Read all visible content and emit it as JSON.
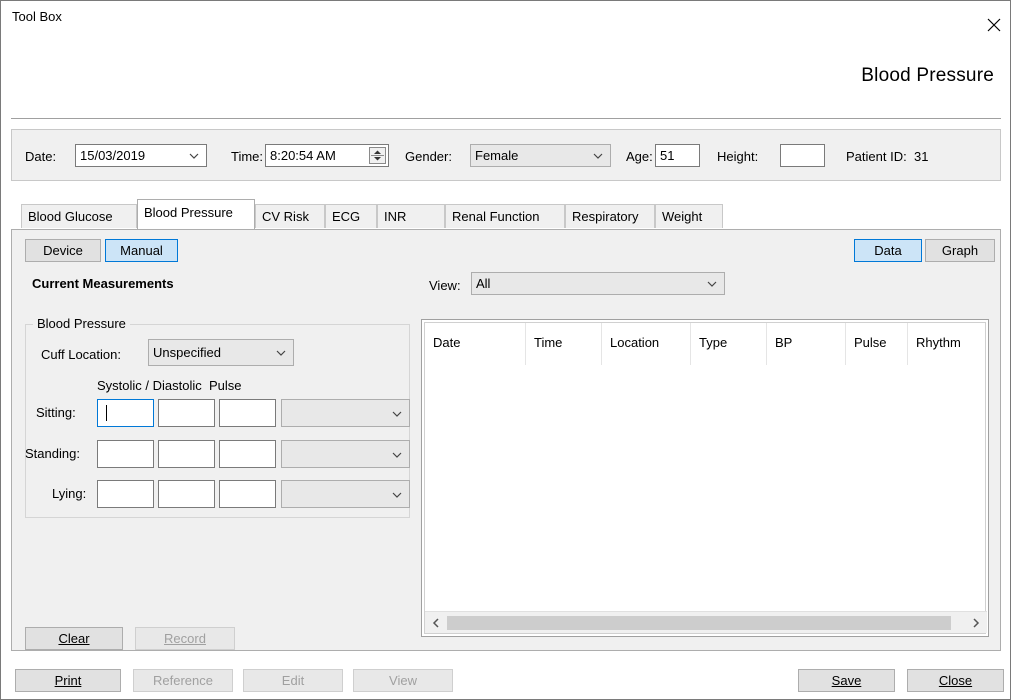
{
  "window": {
    "title": "Tool Box"
  },
  "header": {
    "title": "Blood Pressure"
  },
  "patient": {
    "date_label": "Date:",
    "date_value": "15/03/2019",
    "time_label": "Time:",
    "time_value": "8:20:54 AM",
    "gender_label": "Gender:",
    "gender_value": "Female",
    "age_label": "Age:",
    "age_value": "51",
    "height_label": "Height:",
    "height_value": "",
    "patient_id_label": "Patient ID:",
    "patient_id_value": "31"
  },
  "tabs": [
    {
      "label": "Blood Glucose"
    },
    {
      "label": "Blood Pressure"
    },
    {
      "label": "CV Risk"
    },
    {
      "label": "ECG"
    },
    {
      "label": "INR"
    },
    {
      "label": "Renal Function"
    },
    {
      "label": "Respiratory"
    },
    {
      "label": "Weight"
    }
  ],
  "active_tab": "Blood Pressure",
  "mode": {
    "device_label": "Device",
    "manual_label": "Manual"
  },
  "view_toggle": {
    "data_label": "Data",
    "graph_label": "Graph"
  },
  "current_measurements": {
    "title": "Current Measurements"
  },
  "view_filter": {
    "label": "View:",
    "value": "All"
  },
  "bp_group": {
    "title": "Blood Pressure",
    "cuff_label": "Cuff Location:",
    "cuff_value": "Unspecified",
    "columns_label": "Systolic / Diastolic  Pulse",
    "rows": [
      {
        "label": "Sitting:"
      },
      {
        "label": "Standing:"
      },
      {
        "label": "Lying:"
      }
    ]
  },
  "table": {
    "columns": [
      "Date",
      "Time",
      "Location",
      "Type",
      "BP",
      "Pulse",
      "Rhythm"
    ]
  },
  "actions": {
    "clear_label": "Clear",
    "record_label": "Record"
  },
  "footer": {
    "print_label": "Print",
    "reference_label": "Reference",
    "edit_label": "Edit",
    "view_label": "View",
    "save_label": "Save",
    "close_label": "Close"
  },
  "colors": {
    "selected_button_bg": "#cce4f7",
    "selected_button_border": "#0078d7",
    "panel_bg": "#f0f0f0"
  }
}
